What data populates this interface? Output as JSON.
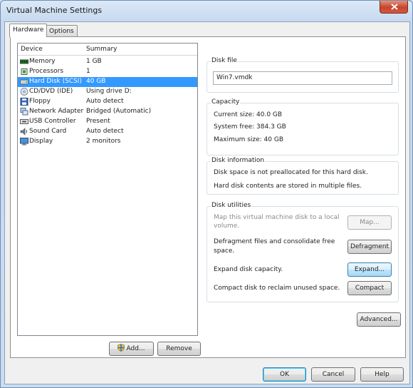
{
  "window": {
    "title": "Virtual Machine Settings"
  },
  "tabs": [
    {
      "label": "Hardware"
    },
    {
      "label": "Options"
    }
  ],
  "device_list": {
    "columns": {
      "device": "Device",
      "summary": "Summary"
    },
    "rows": [
      {
        "icon": "memory-icon",
        "name": "Memory",
        "summary": "1 GB",
        "selected": false
      },
      {
        "icon": "processor-icon",
        "name": "Processors",
        "summary": "1",
        "selected": false
      },
      {
        "icon": "hard-disk-icon",
        "name": "Hard Disk (SCSI)",
        "summary": "40 GB",
        "selected": true
      },
      {
        "icon": "cd-dvd-icon",
        "name": "CD/DVD (IDE)",
        "summary": "Using drive D:",
        "selected": false
      },
      {
        "icon": "floppy-icon",
        "name": "Floppy",
        "summary": "Auto detect",
        "selected": false
      },
      {
        "icon": "network-adapter-icon",
        "name": "Network Adapter",
        "summary": "Bridged (Automatic)",
        "selected": false
      },
      {
        "icon": "usb-icon",
        "name": "USB Controller",
        "summary": "Present",
        "selected": false
      },
      {
        "icon": "sound-card-icon",
        "name": "Sound Card",
        "summary": "Auto detect",
        "selected": false
      },
      {
        "icon": "display-icon",
        "name": "Display",
        "summary": "2 monitors",
        "selected": false
      }
    ]
  },
  "device_buttons": {
    "add": "Add...",
    "remove": "Remove"
  },
  "disk_file": {
    "legend": "Disk file",
    "value": "Win7.vmdk"
  },
  "capacity": {
    "legend": "Capacity",
    "current_size": "Current size: 40.0 GB",
    "system_free": "System free: 384.3 GB",
    "maximum_size": "Maximum size: 40 GB"
  },
  "disk_information": {
    "legend": "Disk information",
    "line1": "Disk space is not preallocated for this hard disk.",
    "line2": "Hard disk contents are stored in multiple files."
  },
  "disk_utilities": {
    "legend": "Disk utilities",
    "map_text_1": "Map this virtual machine disk to a local",
    "map_text_2": "volume.",
    "map_button": "Map...",
    "defrag_text_1": "Defragment files and consolidate free",
    "defrag_text_2": "space.",
    "defrag_button": "Defragment",
    "expand_text": "Expand disk capacity.",
    "expand_button": "Expand...",
    "compact_text": "Compact disk to reclaim unused space.",
    "compact_button": "Compact"
  },
  "advanced_button": "Advanced...",
  "footer": {
    "ok": "OK",
    "cancel": "Cancel",
    "help": "Help"
  },
  "colors": {
    "selection": "#3399ff",
    "close_button": "#c6452c"
  }
}
